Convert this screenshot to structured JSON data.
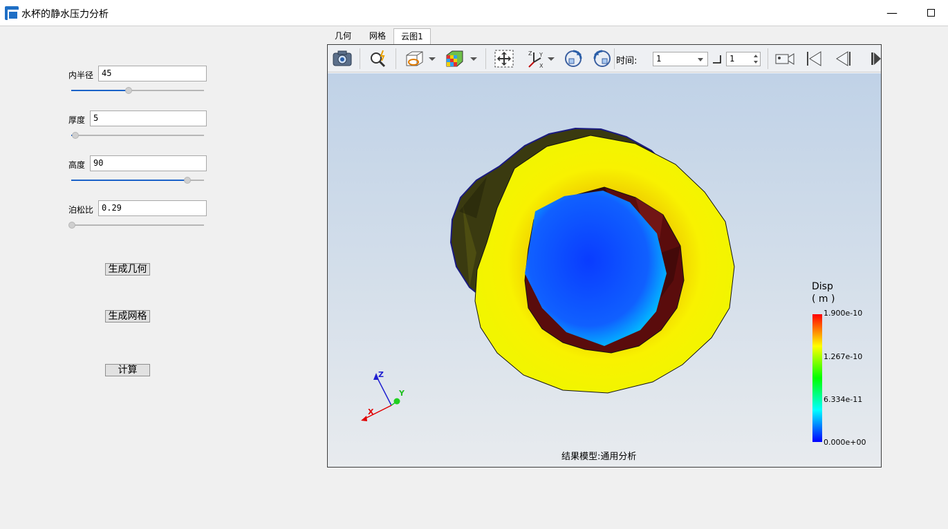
{
  "window": {
    "title": "水杯的静水压力分析",
    "minimize_glyph": "—",
    "icon": "app-icon"
  },
  "params": {
    "inner_radius": {
      "label": "内半径",
      "value": "45",
      "slider_fraction": 0.45
    },
    "thickness": {
      "label": "厚度",
      "value": "5",
      "slider_fraction": 0.03
    },
    "height": {
      "label": "高度",
      "value": "90",
      "slider_fraction": 0.92
    },
    "poisson": {
      "label": "泊松比",
      "value": "0.29",
      "slider_fraction": 0.0
    }
  },
  "actions": {
    "gen_geometry": "生成几何",
    "gen_mesh": "生成网格",
    "compute": "计算"
  },
  "tabs": [
    {
      "label": "几何",
      "active": false
    },
    {
      "label": "网格",
      "active": false
    },
    {
      "label": "云图1",
      "active": true
    }
  ],
  "toolbar": {
    "icons": [
      "camera-icon",
      "zoom-icon",
      "display-mode-icon",
      "color-cube-icon",
      "fit-view-icon",
      "axes-icon",
      "rotate-cw-icon",
      "rotate-ccw-icon",
      "camera-record-icon",
      "first-frame-icon",
      "prev-frame-icon",
      "next-frame-icon"
    ],
    "time_label": "时间:",
    "time_value": "1",
    "step_value": "1"
  },
  "legend": {
    "title": "Disp",
    "unit": "( m )",
    "ticks": [
      "1.900e-10",
      "1.267e-10",
      "6.334e-11",
      "0.000e+00"
    ],
    "colors": [
      "#ff0000",
      "#ffff00",
      "#00ff00",
      "#00ffff",
      "#0000ff"
    ]
  },
  "axes_triad": {
    "x": "X",
    "y": "Y",
    "z": "Z"
  },
  "model_label": "结果模型:通用分析"
}
